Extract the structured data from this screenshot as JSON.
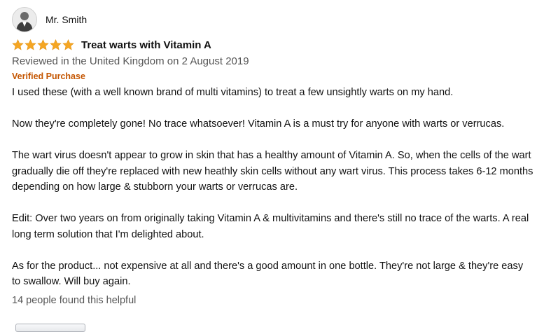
{
  "review": {
    "reviewer_name": "Mr. Smith",
    "rating": 5,
    "rating_max": 5,
    "star_color": "#f5a623",
    "title": "Treat warts with Vitamin A",
    "date_line": "Reviewed in the United Kingdom on 2 August 2019",
    "verified_label": "Verified Purchase",
    "verified_color": "#c45500",
    "paragraphs": [
      "I used these (with a well known brand of multi vitamins) to treat a few unsightly warts on my hand.",
      "Now they're completely gone! No trace whatsoever! Vitamin A is a must try for anyone with warts or verrucas.",
      "The wart virus doesn't appear to grow in skin that has a healthy amount of Vitamin A. So, when the cells of the wart gradually die off they're replaced with new heathly skin cells without any wart virus. This process takes 6-12 months depending on how large & stubborn your warts or verrucas are.",
      "Edit: Over two years on from originally taking Vitamin A & multivitamins and there's still no trace of the warts. A real long term solution that I'm delighted about.",
      "As for the product... not expensive at all and there's a good amount in one bottle. They're not large & they're easy to swallow. Will buy again."
    ],
    "helpful_text": "14 people found this helpful"
  }
}
